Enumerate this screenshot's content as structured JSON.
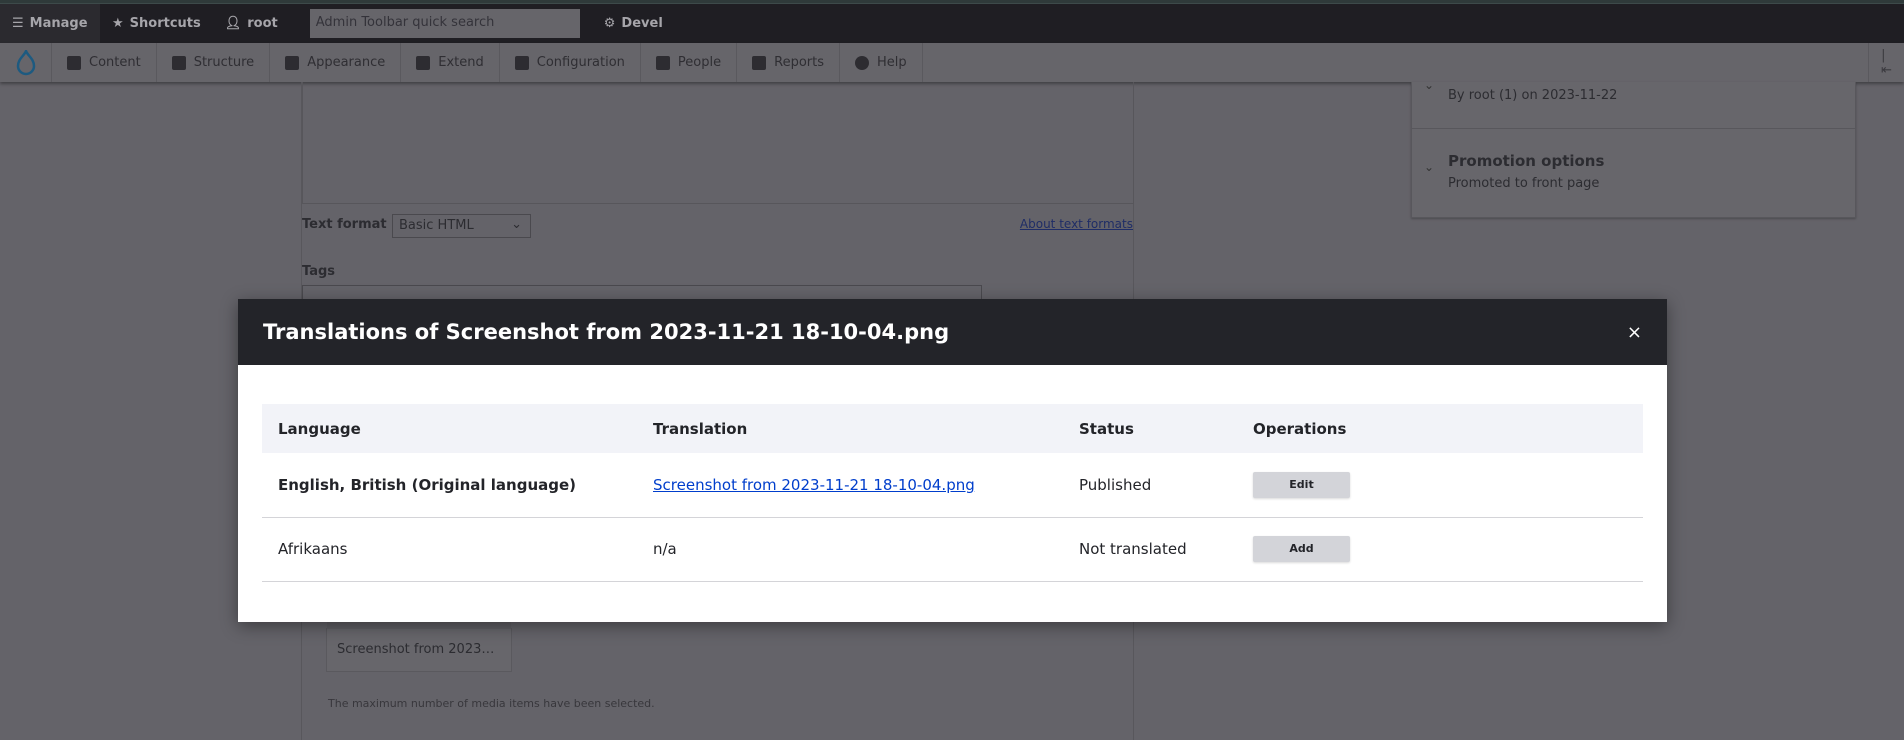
{
  "toolbar": {
    "manage": "Manage",
    "shortcuts": "Shortcuts",
    "user": "root",
    "search_placeholder": "Admin Toolbar quick search",
    "devel": "Devel"
  },
  "menu": [
    {
      "label": "Content"
    },
    {
      "label": "Structure"
    },
    {
      "label": "Appearance"
    },
    {
      "label": "Extend"
    },
    {
      "label": "Configuration"
    },
    {
      "label": "People"
    },
    {
      "label": "Reports"
    },
    {
      "label": "Help"
    }
  ],
  "form": {
    "text_format_label": "Text format",
    "text_format_value": "Basic HTML",
    "about_text_formats": "About text formats",
    "tags_label": "Tags",
    "media_item": "Screenshot from 2023…",
    "max_message": "The maximum number of media items have been selected."
  },
  "sidebar": {
    "authoring": "By root (1) on 2023-11-22",
    "promotion_title": "Promotion options",
    "promotion_summary": "Promoted to front page"
  },
  "modal": {
    "title": "Translations of Screenshot from 2023-11-21 18-10-04.png",
    "close": "×",
    "headers": [
      "Language",
      "Translation",
      "Status",
      "Operations"
    ],
    "rows": [
      {
        "language": "English, British (Original language)",
        "translation": "Screenshot from 2023-11-21 18-10-04.png",
        "status": "Published",
        "operation": "Edit"
      },
      {
        "language": "Afrikaans",
        "translation": "n/a",
        "status": "Not translated",
        "operation": "Add"
      }
    ]
  }
}
